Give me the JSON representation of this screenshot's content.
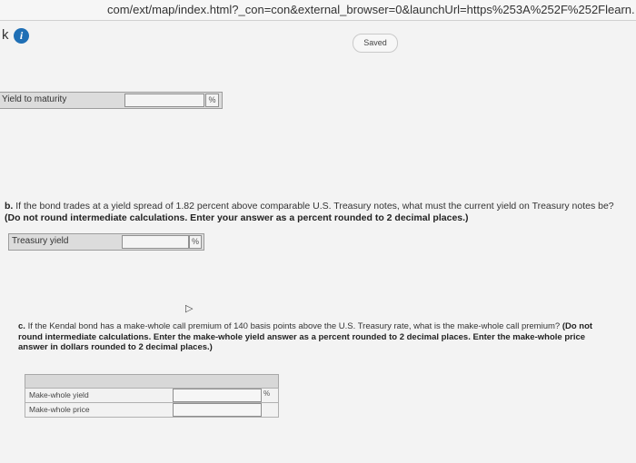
{
  "browser": {
    "url": "com/ext/map/index.html?_con=con&external_browser=0&launchUrl=https%253A%252F%252Flearn."
  },
  "header": {
    "k_label": "k",
    "info_icon": "info-icon",
    "saved_label": "Saved"
  },
  "part_a": {
    "row_label": "Yield to maturity",
    "unit": "%",
    "value": ""
  },
  "part_b": {
    "prefix": "b.",
    "question": "If the bond trades at a yield spread of 1.82 percent above comparable U.S. Treasury notes, what must the current yield on Treasury notes be?",
    "instructions": "(Do not round intermediate calculations. Enter your answer as a percent rounded to 2 decimal places.)",
    "row_label": "Treasury yield",
    "unit": "%",
    "value": ""
  },
  "part_c": {
    "prefix": "c.",
    "question": "If the Kendal bond has a make-whole call premium of 140 basis points above the U.S. Treasury rate, what is the make-whole call premium?",
    "instructions": "(Do not round intermediate calculations. Enter the make-whole yield answer as a percent rounded to 2 decimal places. Enter the make-whole price answer in dollars rounded to 2 decimal places.)",
    "rows": [
      {
        "label": "Make-whole yield",
        "unit": "%",
        "value": ""
      },
      {
        "label": "Make-whole price",
        "unit": "",
        "value": ""
      }
    ]
  }
}
